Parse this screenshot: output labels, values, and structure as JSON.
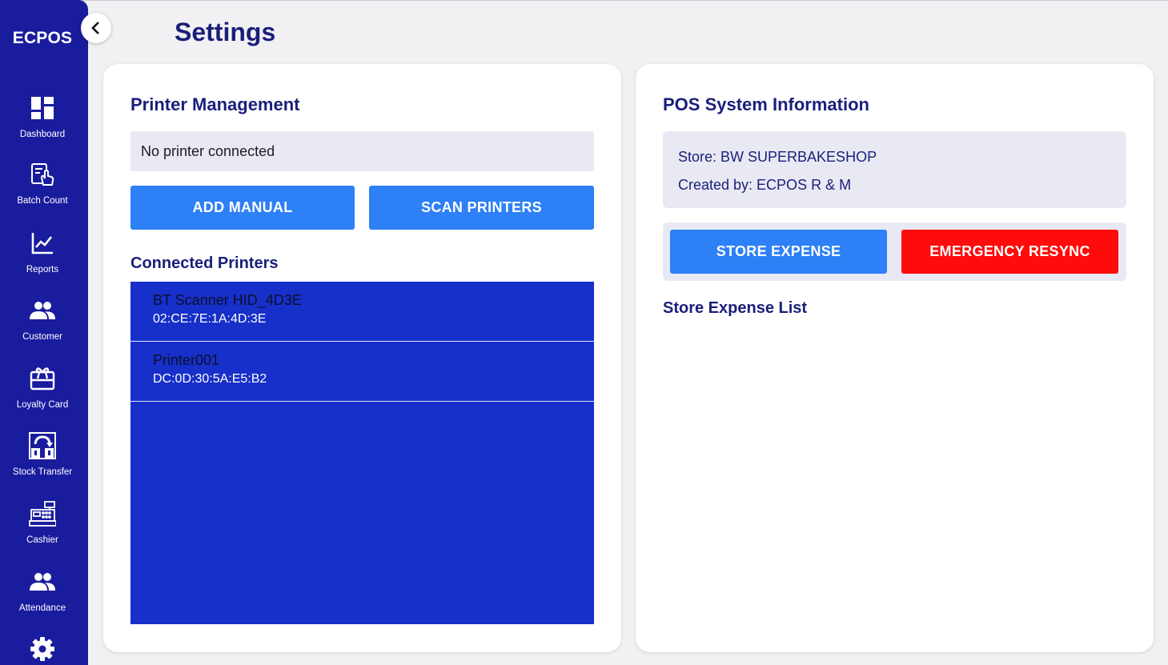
{
  "sidebar": {
    "brand": "ECPOS",
    "items": [
      {
        "label": "Dashboard",
        "icon": "dashboard-icon"
      },
      {
        "label": "Batch Count",
        "icon": "batch-count-icon"
      },
      {
        "label": "Reports",
        "icon": "chart-line-icon"
      },
      {
        "label": "Customer",
        "icon": "people-icon"
      },
      {
        "label": "Loyalty Card",
        "icon": "gift-card-icon"
      },
      {
        "label": "Stock Transfer",
        "icon": "transfer-icon"
      },
      {
        "label": "Cashier",
        "icon": "cash-register-icon"
      },
      {
        "label": "Attendance",
        "icon": "people-icon"
      },
      {
        "label": "",
        "icon": "gear-icon"
      }
    ]
  },
  "header": {
    "title": "Settings",
    "back_icon": "chevron-left-icon"
  },
  "printer_management": {
    "title": "Printer Management",
    "status": "No printer connected",
    "add_manual_label": "ADD MANUAL",
    "scan_printers_label": "SCAN PRINTERS",
    "connected_title": "Connected Printers",
    "printers": [
      {
        "name": "BT Scanner HID_4D3E",
        "mac": "02:CE:7E:1A:4D:3E"
      },
      {
        "name": "Printer001",
        "mac": "DC:0D:30:5A:E5:B2"
      }
    ]
  },
  "pos_info": {
    "title": "POS System Information",
    "store": "Store: BW SUPERBAKESHOP",
    "created_by": "Created by: ECPOS R & M",
    "store_expense_label": "STORE EXPENSE",
    "emergency_resync_label": "EMERGENCY RESYNC",
    "expense_list_title": "Store Expense List"
  },
  "colors": {
    "sidebar": "#1a1c9e",
    "primary_button": "#2d80f6",
    "danger_button": "#ff0b0b",
    "printer_list_bg": "#1730c9",
    "heading": "#1a1f7a"
  }
}
